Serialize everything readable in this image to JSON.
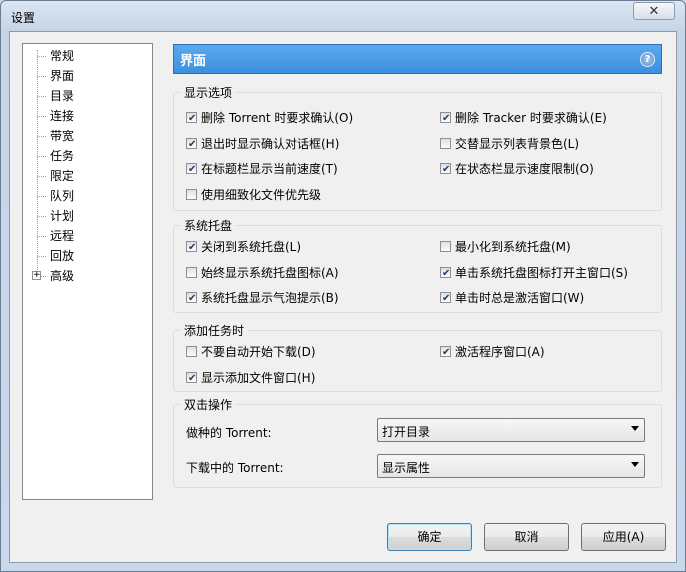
{
  "window": {
    "title": "设置",
    "close_glyph": "✕"
  },
  "tree": {
    "items": [
      {
        "label": "常规"
      },
      {
        "label": "界面"
      },
      {
        "label": "目录"
      },
      {
        "label": "连接"
      },
      {
        "label": "带宽"
      },
      {
        "label": "任务"
      },
      {
        "label": "限定"
      },
      {
        "label": "队列"
      },
      {
        "label": "计划"
      },
      {
        "label": "远程"
      },
      {
        "label": "回放"
      },
      {
        "label": "高级",
        "expandable": true
      }
    ],
    "selected": "界面",
    "expander_glyph": "+"
  },
  "header": {
    "title": "界面",
    "help_glyph": "?"
  },
  "display_options": {
    "title": "显示选项",
    "items": [
      {
        "label": "删除 Torrent 时要求确认(O)",
        "checked": true
      },
      {
        "label": "删除 Tracker 时要求确认(E)",
        "checked": true
      },
      {
        "label": "退出时显示确认对话框(H)",
        "checked": true
      },
      {
        "label": "交替显示列表背景色(L)",
        "checked": false
      },
      {
        "label": "在标题栏显示当前速度(T)",
        "checked": true
      },
      {
        "label": "在状态栏显示速度限制(O)",
        "checked": true
      },
      {
        "label": "使用细致化文件优先级",
        "checked": false
      }
    ]
  },
  "tray": {
    "title": "系统托盘",
    "items": [
      {
        "label": "关闭到系统托盘(L)",
        "checked": true
      },
      {
        "label": "最小化到系统托盘(M)",
        "checked": false
      },
      {
        "label": "始终显示系统托盘图标(A)",
        "checked": false
      },
      {
        "label": "单击系统托盘图标打开主窗口(S)",
        "checked": true
      },
      {
        "label": "系统托盘显示气泡提示(B)",
        "checked": true
      },
      {
        "label": "单击时总是激活窗口(W)",
        "checked": true
      }
    ]
  },
  "add_task": {
    "title": "添加任务时",
    "items": [
      {
        "label": "不要自动开始下载(D)",
        "checked": false
      },
      {
        "label": "激活程序窗口(A)",
        "checked": true
      },
      {
        "label": "显示添加文件窗口(H)",
        "checked": true
      }
    ]
  },
  "double_click": {
    "title": "双击操作",
    "rows": [
      {
        "label": "做种的 Torrent:",
        "value": "打开目录"
      },
      {
        "label": "下载中的 Torrent:",
        "value": "显示属性"
      }
    ]
  },
  "buttons": {
    "ok": "确定",
    "cancel": "取消",
    "apply": "应用(A)"
  },
  "check_glyph": "✔"
}
